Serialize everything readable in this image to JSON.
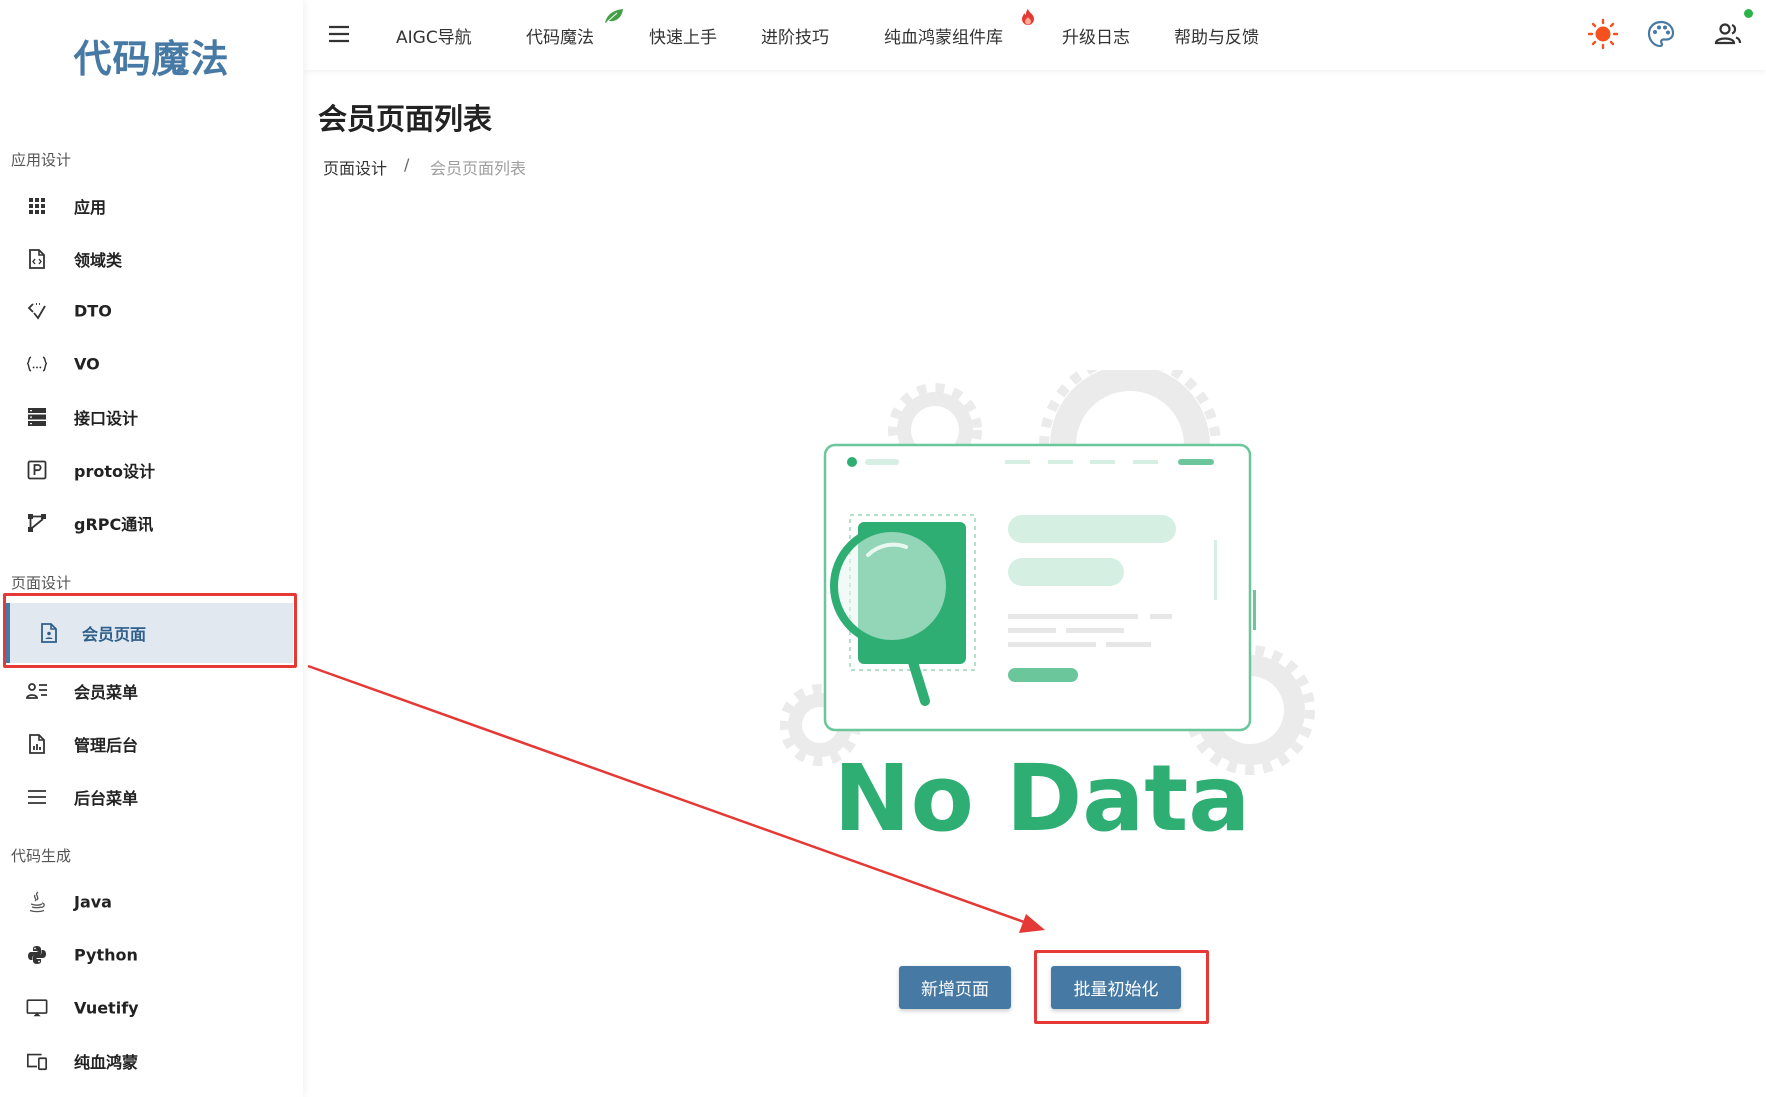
{
  "brand": "代码魔法",
  "header": {
    "nav": [
      {
        "label": "AIGC导航"
      },
      {
        "label": "代码魔法"
      },
      {
        "label": "快速上手"
      },
      {
        "label": "进阶技巧"
      },
      {
        "label": "纯血鸿蒙组件库"
      },
      {
        "label": "升级日志"
      },
      {
        "label": "帮助与反馈"
      }
    ],
    "icons": [
      "menu-icon",
      "sun-icon",
      "palette-icon",
      "users-icon"
    ]
  },
  "sidebar": {
    "sections": [
      {
        "title": "应用设计",
        "items": [
          {
            "label": "应用",
            "icon": "grid-icon"
          },
          {
            "label": "领域类",
            "icon": "code-file-icon"
          },
          {
            "label": "DTO",
            "icon": "code-arrows-icon"
          },
          {
            "label": "VO",
            "icon": "braces-icon"
          },
          {
            "label": "接口设计",
            "icon": "server-icon"
          },
          {
            "label": "proto设计",
            "icon": "p-box-icon"
          },
          {
            "label": "gRPC通讯",
            "icon": "branch-icon"
          }
        ]
      },
      {
        "title": "页面设计",
        "items": [
          {
            "label": "会员页面",
            "icon": "account-file-icon",
            "active": true
          },
          {
            "label": "会员菜单",
            "icon": "account-list-icon"
          },
          {
            "label": "管理后台",
            "icon": "chart-file-icon"
          },
          {
            "label": "后台菜单",
            "icon": "menu-lines-icon"
          }
        ]
      },
      {
        "title": "代码生成",
        "items": [
          {
            "label": "Java",
            "icon": "java-icon"
          },
          {
            "label": "Python",
            "icon": "python-icon"
          },
          {
            "label": "Vuetify",
            "icon": "monitor-icon"
          },
          {
            "label": "纯血鸿蒙",
            "icon": "devices-icon"
          }
        ]
      }
    ]
  },
  "main": {
    "title": "会员页面列表",
    "breadcrumb": [
      "页面设计",
      "/",
      "会员页面列表"
    ],
    "empty_text": "No Data",
    "buttons": {
      "new_page": "新增页面",
      "batch_init": "批量初始化"
    }
  },
  "colors": {
    "brand": "#4679a4",
    "illustration_green": "#2fae74",
    "highlight_red": "#e53935",
    "active_bg": "#e1e8f0"
  }
}
